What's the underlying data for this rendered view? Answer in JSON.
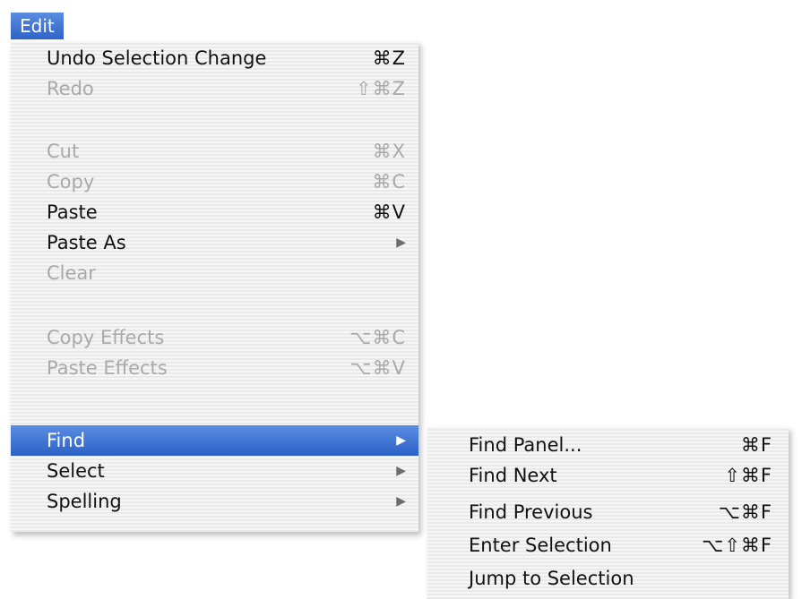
{
  "menubar": {
    "title": "Edit"
  },
  "edit_menu": {
    "items": [
      {
        "label": "Undo Selection Change",
        "shortcut": "⌘Z"
      },
      {
        "label": "Redo",
        "shortcut": "⇧⌘Z"
      },
      {
        "label": "Cut",
        "shortcut": "⌘X"
      },
      {
        "label": "Copy",
        "shortcut": "⌘C"
      },
      {
        "label": "Paste",
        "shortcut": "⌘V"
      },
      {
        "label": "Paste As",
        "arrow": "▶"
      },
      {
        "label": "Clear"
      },
      {
        "label": "Copy Effects",
        "shortcut": "⌥⌘C"
      },
      {
        "label": "Paste Effects",
        "shortcut": "⌥⌘V"
      },
      {
        "label": "Find",
        "arrow": "▶"
      },
      {
        "label": "Select",
        "arrow": "▶"
      },
      {
        "label": "Spelling",
        "arrow": "▶"
      }
    ]
  },
  "find_submenu": {
    "items": [
      {
        "label": "Find Panel...",
        "shortcut": "⌘F"
      },
      {
        "label": "Find Next",
        "shortcut": "⇧⌘F"
      },
      {
        "label": "Find Previous",
        "shortcut": "⌥⌘F"
      },
      {
        "label": "Enter Selection",
        "shortcut": "⌥⇧⌘F"
      },
      {
        "label": "Jump to Selection"
      }
    ]
  },
  "colors": {
    "highlight": "#3a6fd3",
    "disabled_text": "#a9a9a9",
    "enabled_text": "#111111"
  }
}
